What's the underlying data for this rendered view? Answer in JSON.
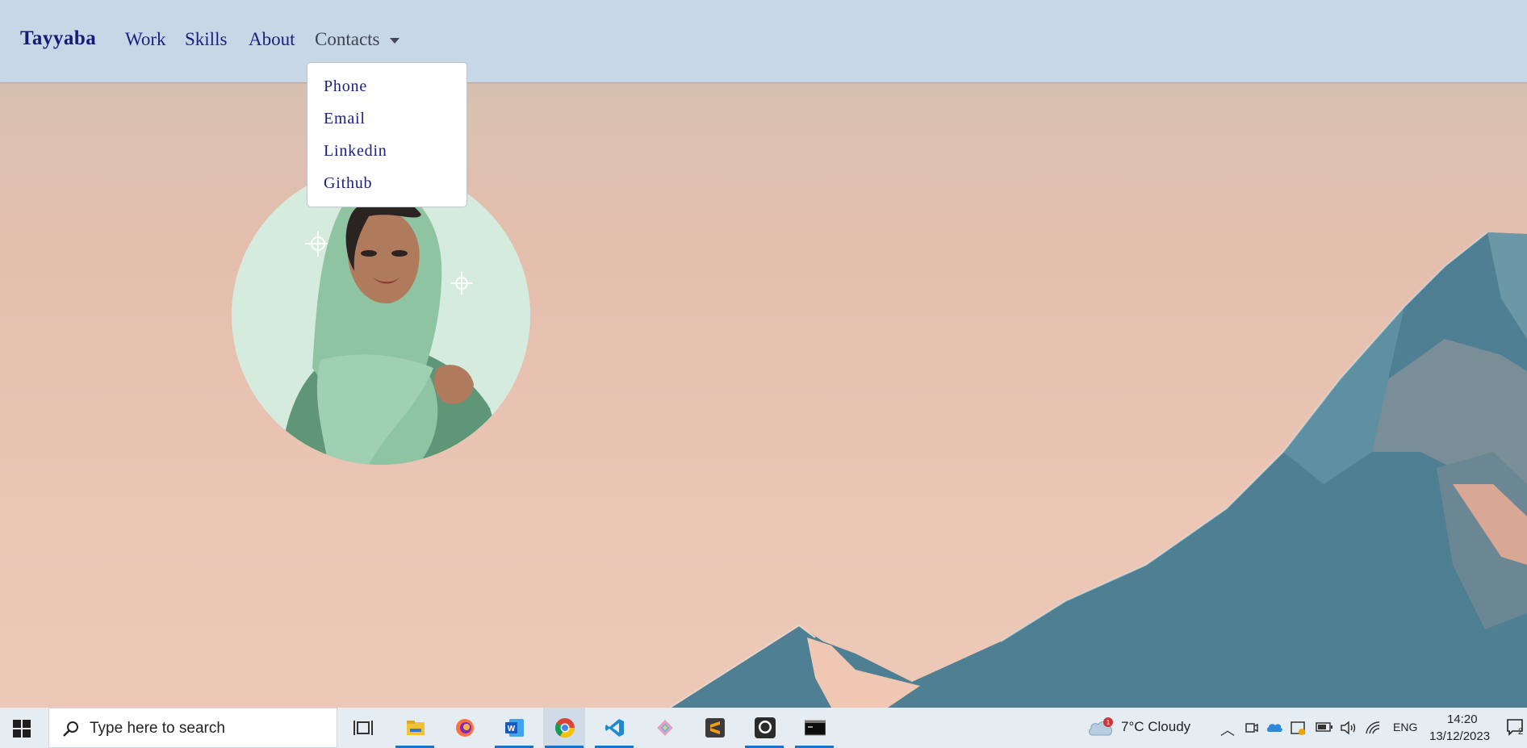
{
  "navbar": {
    "brand": "Tayyaba",
    "links": [
      "Work",
      "Skills",
      "About"
    ],
    "contacts_label": "Contacts"
  },
  "dropdown": {
    "items": [
      "Phone",
      "Email",
      "Linkedin",
      "Github"
    ]
  },
  "taskbar": {
    "search_placeholder": "Type here to search",
    "weather_badge": "1",
    "weather": "7°C  Cloudy",
    "language": "ENG",
    "time": "14:20",
    "date": "13/12/2023",
    "notification_count": "2",
    "apps": [
      "task-view-icon",
      "file-explorer-icon",
      "firefox-icon",
      "word-icon",
      "chrome-icon",
      "vscode-icon",
      "git-icon",
      "sublime-icon",
      "github-icon",
      "terminal-icon"
    ]
  },
  "colors": {
    "navbar_bg": "#c7d7e5",
    "brand": "#151a78",
    "link": "#1c2083",
    "mountain": "#4c7d90"
  }
}
